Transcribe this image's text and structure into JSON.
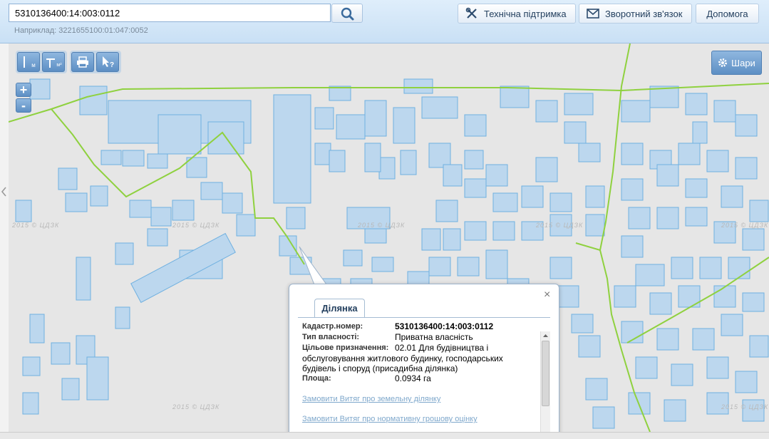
{
  "search": {
    "value": "5310136400:14:003:0112",
    "example": "Наприклад: 3221655100:01:047:0052"
  },
  "header": {
    "support_label": "Технічна підтримка",
    "feedback_label": "Зворотний зв'язок",
    "help_label": "Допомога"
  },
  "toolbar": {
    "measure_length_label": "м",
    "measure_area_label": "м²",
    "zoom_in": "+",
    "zoom_out": "-",
    "layers_label": "Шари"
  },
  "map": {
    "watermark": "2015 © ЦДЗК"
  },
  "popup": {
    "tab_label": "Ділянка",
    "close": "×",
    "fields": {
      "cadastral_label": "Кадастр.номер:",
      "cadastral_value": "5310136400:14:003:0112",
      "ownership_label": "Тип власності:",
      "ownership_value": "Приватна власність",
      "purpose_label": "Цільове призначення:",
      "purpose_value_line1": "02.01 Для будівництва і",
      "purpose_value_line2": "обслуговування житлового будинку, господарських будівель і споруд (присадибна ділянка)",
      "area_label": "Площа:",
      "area_value": "0.0934 га"
    },
    "link1": "Замовити Витяг про земельну ділянку",
    "link2": "Замовити Витяг про нормативну грошову оцінку"
  },
  "colors": {
    "parcel_fill": "#bcd7ee",
    "parcel_stroke": "#6fb0e0",
    "boundary": "#8fd13f",
    "accent": "#24405f"
  }
}
